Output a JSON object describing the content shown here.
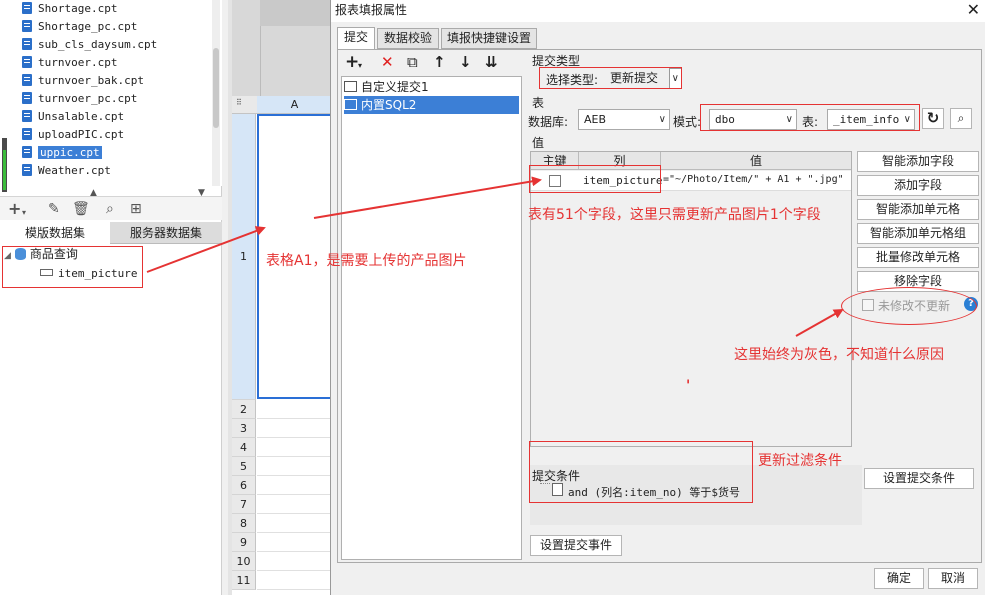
{
  "left_panel": {
    "files": [
      "Shortage.cpt",
      "Shortage_pc.cpt",
      "sub_cls_daysum.cpt",
      "turnvoer.cpt",
      "turnvoer_bak.cpt",
      "turnvoer_pc.cpt",
      "Unsalable.cpt",
      "uploadPIC.cpt",
      "uppic.cpt",
      "Weather.cpt"
    ],
    "selected_file": "uppic.cpt",
    "tabs": [
      "模版数据集",
      "服务器数据集"
    ],
    "dataset_name": "商品查询",
    "field_name": "item_picture"
  },
  "sheet": {
    "column_a": "A",
    "rows": [
      "1",
      "2",
      "3",
      "4",
      "5",
      "6",
      "7",
      "8",
      "9",
      "10",
      "11"
    ]
  },
  "dialog": {
    "title": "报表填报属性",
    "close": "✕",
    "tabs": [
      "提交",
      "数据校验",
      "填报快捷键设置"
    ],
    "list_items": [
      "自定义提交1",
      "内置SQL2"
    ],
    "submit_type_label": "提交类型",
    "select_type_label": "选择类型:",
    "select_type_value": "更新提交",
    "table_section_label": "表",
    "database_label": "数据库:",
    "database_value": "AEB",
    "mode_label": "模式:",
    "mode_value": "dbo",
    "table_label": "表:",
    "table_value": "_item_info",
    "value_section_label": "值",
    "col_headers": [
      "主键",
      "列",
      "值"
    ],
    "row": {
      "column": "item_picture",
      "value": "=\"~/Photo/Item/\" + A1 + \".jpg\""
    },
    "side_buttons": [
      "智能添加字段",
      "添加字段",
      "智能添加单元格",
      "智能添加单元格组",
      "批量修改单元格",
      "移除字段"
    ],
    "no_update_label": "未修改不更新",
    "condition_label": "提交条件",
    "condition_text": "and (列名:item_no) 等于$货号",
    "set_condition_button": "设置提交条件",
    "set_event_button": "设置提交事件",
    "ok_button": "确定",
    "cancel_button": "取消"
  },
  "annotations": {
    "a1_note": "表格A1，是需要上传的产品图片",
    "fields_note": "表有51个字段，这里只需更新产品图片1个字段",
    "gray_note": "这里始终为灰色，不知道什么原因",
    "filter_note": "更新过滤条件",
    "mark": "'"
  },
  "colors": {
    "annotation": "#e53333",
    "selection": "#3c7fd6"
  }
}
